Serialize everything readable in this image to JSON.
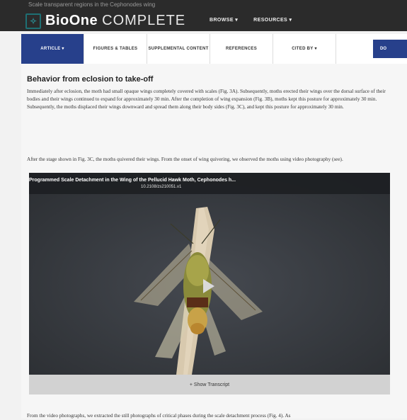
{
  "behind_heading": "Scale transparent regions in the Cephonodes wing",
  "header": {
    "brand_name": "BioOne",
    "brand_suffix": "COMPLETE",
    "nav": [
      "BROWSE ▾",
      "RESOURCES ▾"
    ]
  },
  "tabs": [
    "ARTICLE ▾",
    "FIGURES & TABLES",
    "SUPPLEMENTAL CONTENT",
    "REFERENCES",
    "CITED BY ▾"
  ],
  "tab_cta": "DO",
  "section_title": "Behavior from eclosion to take-off",
  "paragraph1": "Immediately after eclosion, the moth had small opaque wings completely covered with scales (Fig. 3A). Subsequently, moths erected their wings over the dorsal surface of their bodies and their wings continued to expand for approximately 30 min. After the completion of wing expansion (Fig. 3B), moths kept this posture for approximately 30 min. Subsequently, the moths displaced their wings downward and spread them along their body sides (Fig. 3C), and kept this posture for approximately 30 min.",
  "paragraph2": "After the stage shown in Fig. 3C, the moths quivered their wings. From the onset of wing quivering, we observed the moths using video photography (see).",
  "video": {
    "title": "Programmed Scale Detachment in the Wing of the Pellucid Hawk Moth, Cephonodes h...",
    "id": "10.2108/zs210051.v1",
    "transcript_label": "+ Show Transcript",
    "colors": {
      "background": "#373a3f",
      "bar": "#d2d2d2"
    }
  },
  "paragraph3": "From the video photographs, we extracted the still photographs of critical phases during the scale detachment process (Fig. 4). As",
  "colors": {
    "accent": "#27408b",
    "header_bg": "#2b2b2b",
    "brand_teal": "#2a8a8f"
  }
}
